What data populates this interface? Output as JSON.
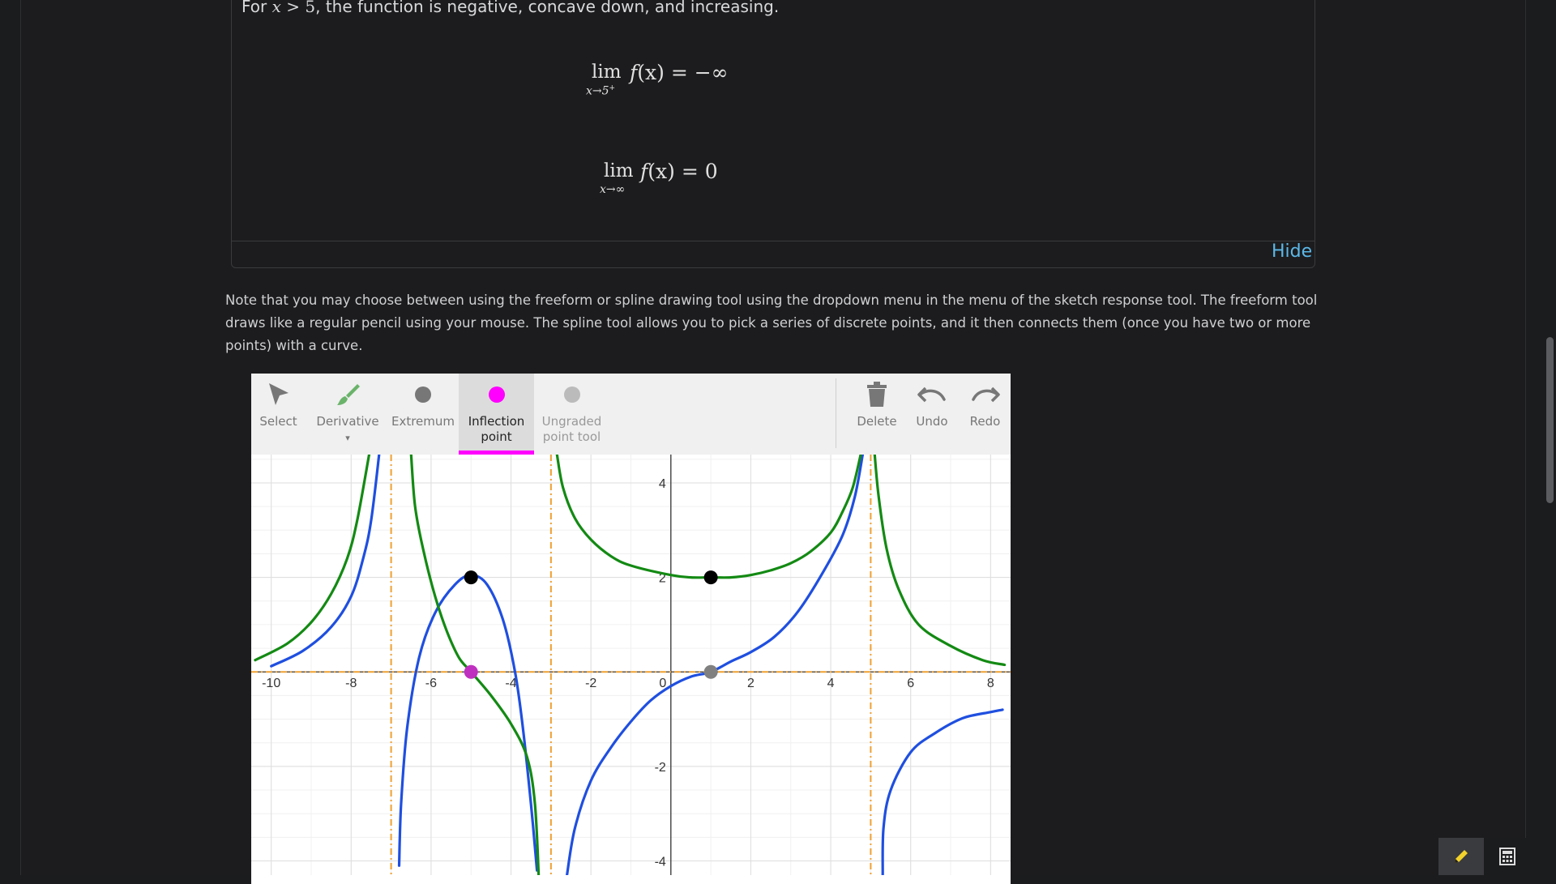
{
  "solution": {
    "line_prefix": "For ",
    "line_var": "x",
    "line_op": " > ",
    "line_num": "5",
    "line_suffix": ", the function is negative, concave down, and increasing.",
    "limit1": {
      "word": "lim",
      "sub": "x→5",
      "sup": "+",
      "expr_f": "f",
      "expr_arg": "(x)",
      "expr_rhs": " = −∞"
    },
    "limit2": {
      "word": "lim",
      "sub": "x→∞",
      "expr_f": "f",
      "expr_arg": "(x)",
      "expr_rhs": " = 0"
    },
    "hide_label": "Hide"
  },
  "note_text": "Note that you may choose between using the freeform or spline drawing tool using the dropdown menu in the menu of the sketch response tool. The freeform tool draws like a regular pencil using your mouse. The spline tool allows you to pick a series of discrete points, and it then connects them (once you have two or more points) with a curve.",
  "toolbar": {
    "select_label": "Select",
    "derivative_label": "Derivative",
    "derivative_caret": "▾",
    "extremum_label": "Extremum",
    "inflection_line1": "Inflection",
    "inflection_line2": "point",
    "ungraded_line1": "Ungraded",
    "ungraded_line2": "point tool",
    "delete_label": "Delete",
    "undo_label": "Undo",
    "redo_label": "Redo",
    "active_tool": "Inflection point",
    "colors": {
      "derivative": "#6bb36b",
      "inflection": "#ff00ff",
      "extremum": "#777777",
      "ungraded": "#bbbbbb"
    }
  },
  "icons": {
    "select": "cursor-arrow-icon",
    "derivative": "paintbrush-icon",
    "extremum": "dot-icon",
    "inflection": "dot-icon",
    "ungraded": "dot-icon",
    "delete": "trash-icon",
    "undo": "undo-icon",
    "redo": "redo-icon",
    "pencil": "pencil-icon",
    "calculator": "calculator-icon"
  },
  "chart_data": {
    "type": "line",
    "xlim": [
      -10.5,
      8.5
    ],
    "ylim": [
      -4.3,
      4.6
    ],
    "x_ticks": [
      -10,
      -8,
      -6,
      -4,
      -2,
      0,
      2,
      4,
      6,
      8
    ],
    "y_ticks": [
      -4,
      -2,
      2,
      4
    ],
    "x_tick_labels": [
      "-10",
      "-8",
      "-6",
      "-4",
      "-2",
      "0",
      "2",
      "4",
      "6",
      "8"
    ],
    "y_tick_labels": [
      "-4",
      "-2",
      "2",
      "4"
    ],
    "grid": true,
    "asymptotes_x": [
      -7,
      -3,
      5
    ],
    "asymptote_y": 0,
    "asymptote_color": "#f0a030",
    "series": [
      {
        "color": "#1f4fe0",
        "segments": [
          [
            [
              -10,
              0.12
            ],
            [
              -9.2,
              0.45
            ],
            [
              -8.5,
              0.95
            ],
            [
              -8,
              1.6
            ],
            [
              -7.7,
              2.4
            ],
            [
              -7.5,
              3.2
            ],
            [
              -7.3,
              4.6
            ]
          ],
          [
            [
              -6.8,
              -4.1
            ],
            [
              -6.75,
              -2.8
            ],
            [
              -6.6,
              -1.2
            ],
            [
              -6.3,
              0.3
            ],
            [
              -5.9,
              1.25
            ],
            [
              -5.4,
              1.85
            ],
            [
              -5,
              2.05
            ],
            [
              -4.6,
              1.85
            ],
            [
              -4.2,
              1.1
            ],
            [
              -3.9,
              0.0
            ],
            [
              -3.7,
              -1.2
            ],
            [
              -3.5,
              -2.8
            ],
            [
              -3.35,
              -4.2
            ]
          ],
          [
            [
              -2.6,
              -4.3
            ],
            [
              -2.4,
              -3.3
            ],
            [
              -2,
              -2.3
            ],
            [
              -1.5,
              -1.6
            ],
            [
              -1,
              -1.05
            ],
            [
              -0.5,
              -0.6
            ],
            [
              0,
              -0.3
            ],
            [
              0.5,
              -0.1
            ],
            [
              1,
              0.0
            ],
            [
              1.5,
              0.22
            ],
            [
              2,
              0.42
            ],
            [
              2.6,
              0.75
            ],
            [
              3.2,
              1.3
            ],
            [
              3.8,
              2.1
            ],
            [
              4.3,
              2.9
            ],
            [
              4.6,
              3.7
            ],
            [
              4.8,
              4.6
            ]
          ],
          [
            [
              5.3,
              -4.3
            ],
            [
              5.32,
              -3.3
            ],
            [
              5.5,
              -2.5
            ],
            [
              6,
              -1.7
            ],
            [
              6.6,
              -1.3
            ],
            [
              7.3,
              -0.98
            ],
            [
              8,
              -0.85
            ],
            [
              8.3,
              -0.8
            ]
          ]
        ]
      },
      {
        "color": "#138a13",
        "segments": [
          [
            [
              -10.4,
              0.25
            ],
            [
              -9.6,
              0.6
            ],
            [
              -9,
              1.05
            ],
            [
              -8.5,
              1.65
            ],
            [
              -8.1,
              2.4
            ],
            [
              -7.85,
              3.2
            ],
            [
              -7.55,
              4.6
            ]
          ],
          [
            [
              -6.5,
              4.6
            ],
            [
              -6.4,
              3.5
            ],
            [
              -6.2,
              2.6
            ],
            [
              -5.9,
              1.6
            ],
            [
              -5.6,
              0.85
            ],
            [
              -5.3,
              0.3
            ],
            [
              -5,
              0.0
            ],
            [
              -4.5,
              -0.5
            ],
            [
              -4,
              -1.1
            ],
            [
              -3.6,
              -1.8
            ],
            [
              -3.4,
              -2.8
            ],
            [
              -3.3,
              -4.5
            ]
          ],
          [
            [
              -2.85,
              4.6
            ],
            [
              -2.7,
              3.9
            ],
            [
              -2.4,
              3.25
            ],
            [
              -2,
              2.8
            ],
            [
              -1.5,
              2.45
            ],
            [
              -1,
              2.25
            ],
            [
              0,
              2.05
            ],
            [
              0.5,
              2.0
            ],
            [
              1,
              2.0
            ],
            [
              1.5,
              2.0
            ],
            [
              2,
              2.05
            ],
            [
              2.5,
              2.15
            ],
            [
              3,
              2.3
            ],
            [
              3.5,
              2.55
            ],
            [
              4,
              2.95
            ],
            [
              4.3,
              3.4
            ],
            [
              4.55,
              3.9
            ],
            [
              4.75,
              4.6
            ]
          ],
          [
            [
              5.1,
              4.6
            ],
            [
              5.2,
              3.7
            ],
            [
              5.4,
              2.6
            ],
            [
              5.7,
              1.75
            ],
            [
              6.2,
              1.0
            ],
            [
              7,
              0.55
            ],
            [
              7.8,
              0.25
            ],
            [
              8.35,
              0.15
            ]
          ]
        ]
      }
    ],
    "points": [
      {
        "x": -5,
        "y": 2,
        "color": "#000000"
      },
      {
        "x": 1,
        "y": 2,
        "color": "#000000"
      },
      {
        "x": -5,
        "y": 0,
        "color": "#c030c0"
      },
      {
        "x": 1,
        "y": 0,
        "color": "#808080"
      }
    ]
  }
}
